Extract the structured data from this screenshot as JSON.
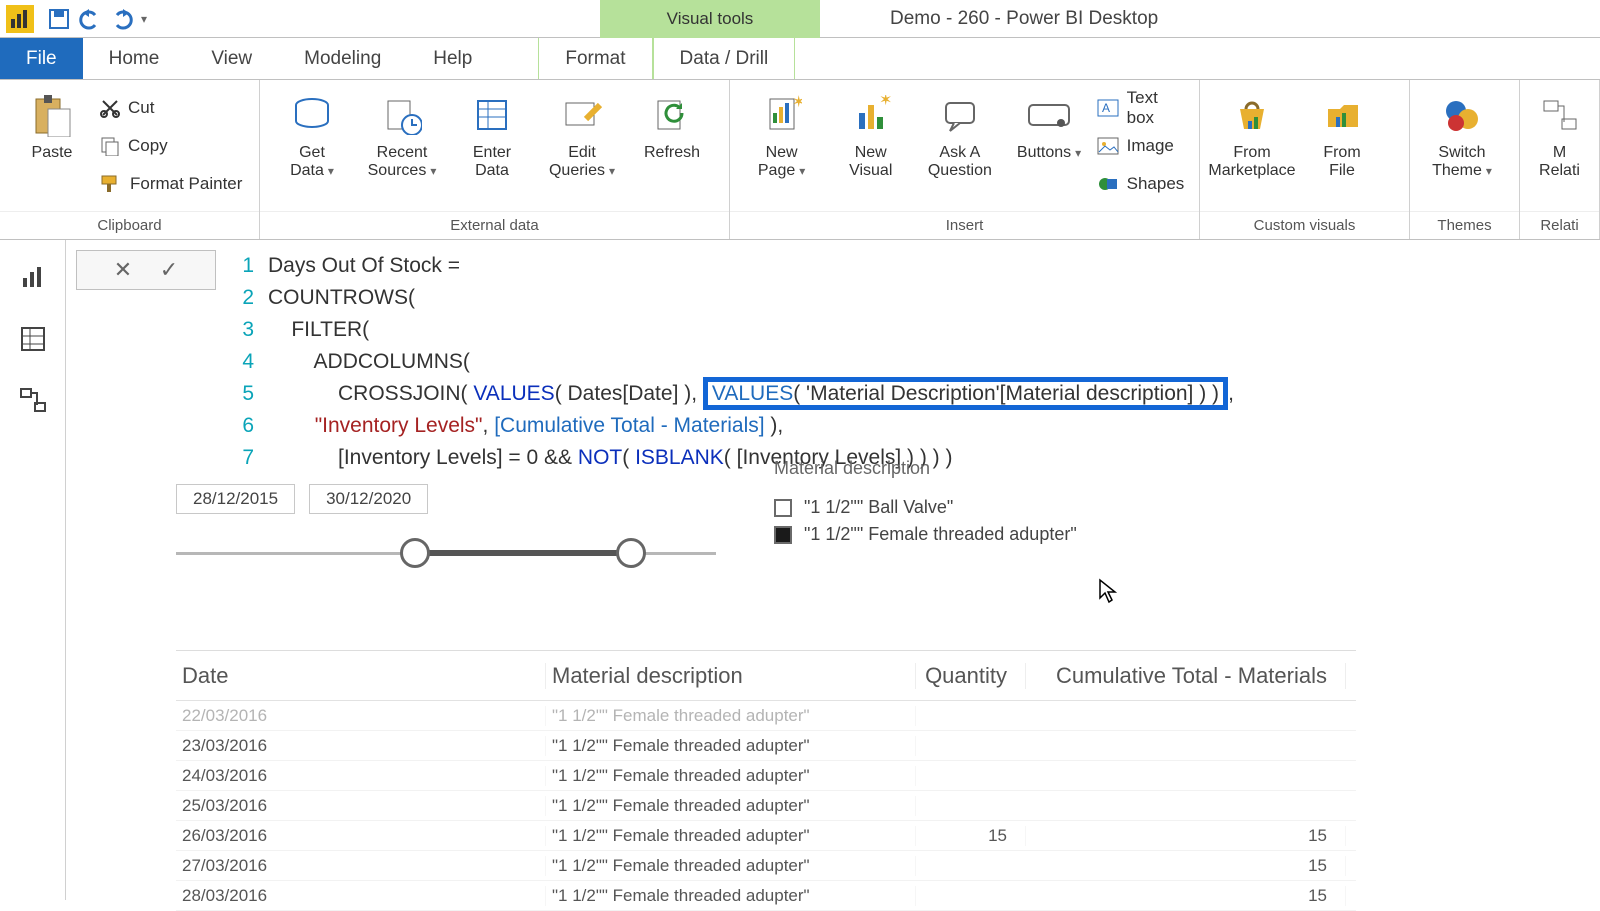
{
  "window": {
    "tool_tab": "Visual tools",
    "title": "Demo - 260 - Power BI Desktop"
  },
  "tabs": {
    "file": "File",
    "home": "Home",
    "view": "View",
    "modeling": "Modeling",
    "help": "Help",
    "format": "Format",
    "data_drill": "Data / Drill"
  },
  "ribbon": {
    "clipboard": {
      "paste": "Paste",
      "cut": "Cut",
      "copy": "Copy",
      "format_painter": "Format Painter",
      "group_label": "Clipboard"
    },
    "external": {
      "get_data": "Get\nData",
      "recent_sources": "Recent\nSources",
      "enter_data": "Enter\nData",
      "edit_queries": "Edit\nQueries",
      "refresh": "Refresh",
      "group_label": "External data"
    },
    "insert": {
      "new_page": "New\nPage",
      "new_visual": "New\nVisual",
      "ask_a_question": "Ask A\nQuestion",
      "buttons": "Buttons",
      "text_box": "Text box",
      "image": "Image",
      "shapes": "Shapes",
      "group_label": "Insert"
    },
    "custom": {
      "from_marketplace": "From\nMarketplace",
      "from_file": "From\nFile",
      "group_label": "Custom visuals"
    },
    "themes": {
      "switch_theme": "Switch\nTheme",
      "group_label": "Themes"
    },
    "rel": {
      "manage": "M\nRelati",
      "group_label": "Relati"
    }
  },
  "formula": {
    "lines": [
      "Days Out Of Stock =",
      "COUNTROWS(",
      "    FILTER(",
      "        ADDCOLUMNS(",
      "            CROSSJOIN( VALUES( Dates[Date] ),",
      "        \"Inventory Levels\", [Cumulative Total - Materials] ),",
      "            [Inventory Levels] = 0 && NOT( ISBLANK( [Inventory Levels] ) ) ) )"
    ],
    "highlight": "VALUES( 'Material Description'[Material description] ) )"
  },
  "slicer": {
    "date_from": "28/12/2015",
    "date_to": "30/12/2020",
    "material_header": "Material description",
    "materials": [
      {
        "label": "\"1 1/2\"\" Ball Valve\"",
        "checked": false
      },
      {
        "label": "\"1 1/2\"\" Female threaded adupter\"",
        "checked": true
      }
    ]
  },
  "table": {
    "headers": {
      "date": "Date",
      "material": "Material description",
      "qty": "Quantity",
      "cum": "Cumulative Total - Materials"
    },
    "rows": [
      {
        "date": "22/03/2016",
        "material": "\"1 1/2\"\" Female threaded adupter\"",
        "qty": "",
        "cum": "",
        "cut": true
      },
      {
        "date": "23/03/2016",
        "material": "\"1 1/2\"\" Female threaded adupter\"",
        "qty": "",
        "cum": ""
      },
      {
        "date": "24/03/2016",
        "material": "\"1 1/2\"\" Female threaded adupter\"",
        "qty": "",
        "cum": ""
      },
      {
        "date": "25/03/2016",
        "material": "\"1 1/2\"\" Female threaded adupter\"",
        "qty": "",
        "cum": ""
      },
      {
        "date": "26/03/2016",
        "material": "\"1 1/2\"\" Female threaded adupter\"",
        "qty": "15",
        "cum": "15"
      },
      {
        "date": "27/03/2016",
        "material": "\"1 1/2\"\" Female threaded adupter\"",
        "qty": "",
        "cum": "15"
      },
      {
        "date": "28/03/2016",
        "material": "\"1 1/2\"\" Female threaded adupter\"",
        "qty": "",
        "cum": "15"
      }
    ]
  }
}
